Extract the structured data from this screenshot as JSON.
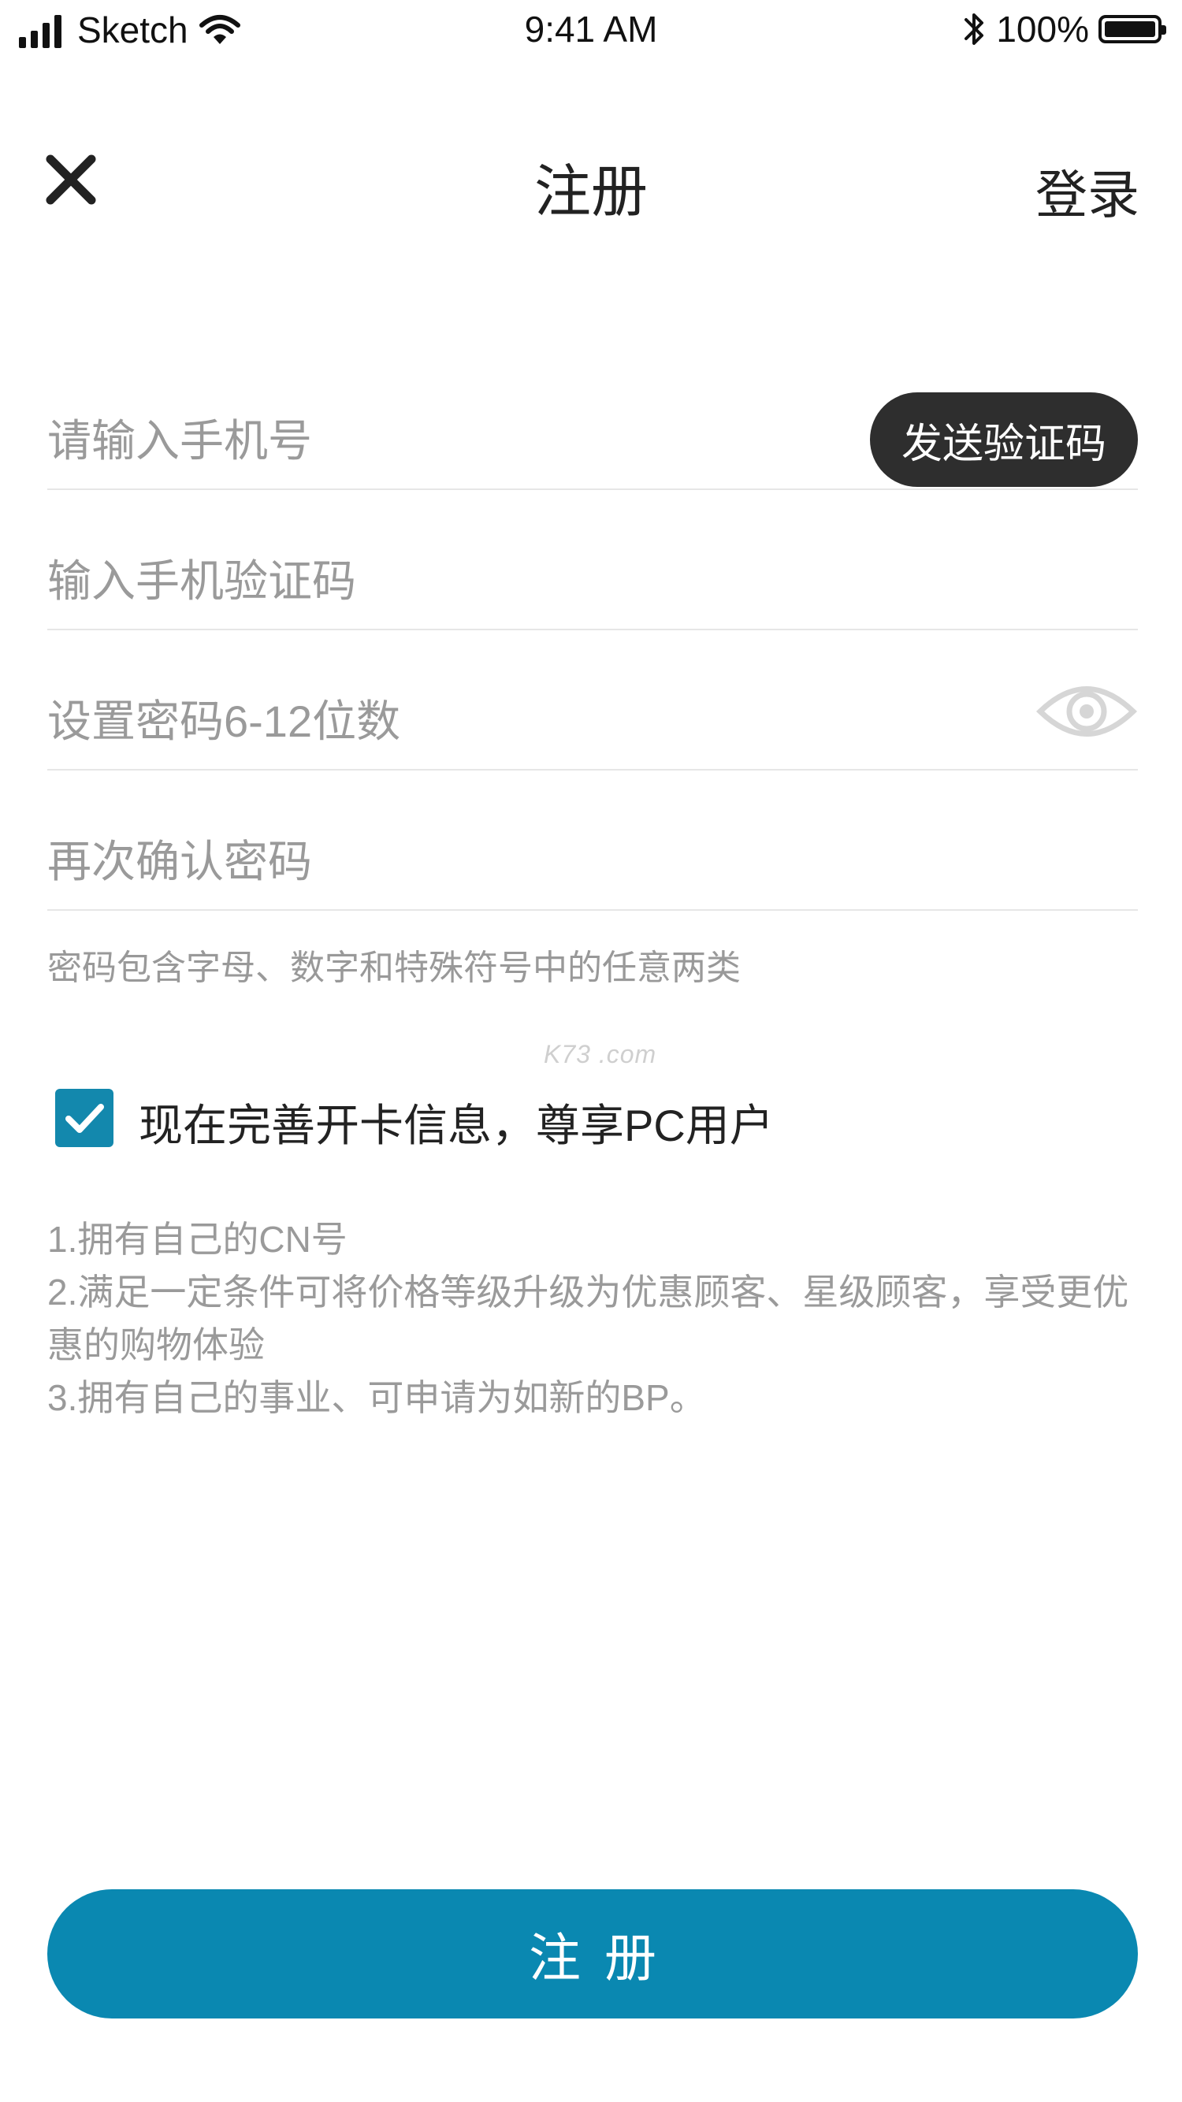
{
  "status_bar": {
    "carrier": "Sketch",
    "time": "9:41 AM",
    "battery": "100%",
    "icons": [
      "signal-icon",
      "wifi-icon",
      "bluetooth-icon",
      "battery-icon"
    ]
  },
  "nav": {
    "close_icon": "close-icon",
    "title": "注册",
    "login_label": "登录"
  },
  "form": {
    "phone_placeholder": "请输入手机号",
    "phone_value": "",
    "send_code_label": "发送验证码",
    "code_placeholder": "输入手机验证码",
    "code_value": "",
    "password_placeholder": "设置密码6-12位数",
    "password_value": "",
    "eye_icon": "eye-icon",
    "confirm_placeholder": "再次确认密码",
    "confirm_value": "",
    "password_hint": "密码包含字母、数字和特殊符号中的任意两类"
  },
  "watermark": "K73 .com",
  "card_option": {
    "checked": true,
    "label": "现在完善开卡信息，尊享PC用户"
  },
  "benefits": [
    "1.拥有自己的CN号",
    "2.满足一定条件可将价格等级升级为优惠顾客、星级顾客，享受更优惠的购物体验",
    "3.拥有自己的事业、可申请为如新的BP。"
  ],
  "submit_label": "注册",
  "colors": {
    "accent": "#0a88b1",
    "checkbox": "#1388ad",
    "send_button": "#2e2e2e",
    "placeholder": "#9a9a9a"
  }
}
